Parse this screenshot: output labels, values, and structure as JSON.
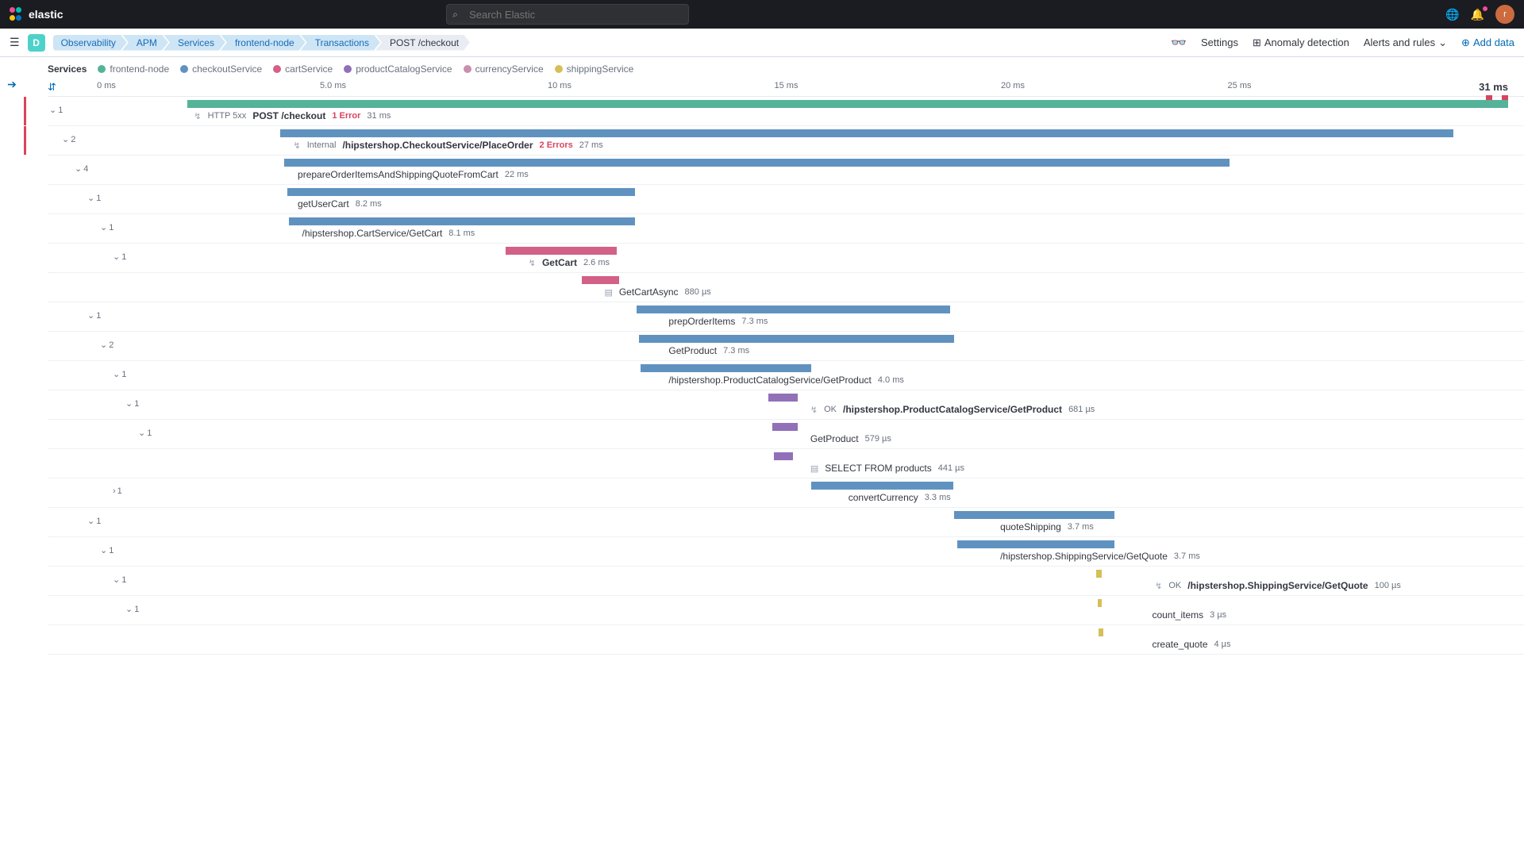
{
  "header": {
    "brand": "elastic",
    "search_placeholder": "Search Elastic",
    "space_initial": "D",
    "avatar_initial": "r"
  },
  "breadcrumbs": [
    "Observability",
    "APM",
    "Services",
    "frontend-node",
    "Transactions",
    "POST /checkout"
  ],
  "nav": {
    "settings": "Settings",
    "anomaly": "Anomaly detection",
    "alerts": "Alerts and rules",
    "add_data": "Add data"
  },
  "legend": {
    "title": "Services",
    "items": [
      {
        "name": "frontend-node",
        "color": "#54b399"
      },
      {
        "name": "checkoutService",
        "color": "#6092c0"
      },
      {
        "name": "cartService",
        "color": "#d36086"
      },
      {
        "name": "productCatalogService",
        "color": "#9170b8"
      },
      {
        "name": "currencyService",
        "color": "#ca8eae"
      },
      {
        "name": "shippingService",
        "color": "#d6bf57"
      }
    ]
  },
  "axis": {
    "ticks": [
      "0 ms",
      "5.0 ms",
      "10 ms",
      "15 ms",
      "20 ms",
      "25 ms"
    ],
    "total": "31 ms"
  },
  "trace": [
    {
      "depth": 0,
      "count": "1",
      "err": true,
      "start": 0.058,
      "width": 0.942,
      "color": "#54b399",
      "icon": "net",
      "pre": "HTTP 5xx",
      "name": "POST /checkout",
      "bold": true,
      "errors": "1 Error",
      "dur": "31 ms",
      "lp": 0.06
    },
    {
      "depth": 1,
      "count": "2",
      "err": true,
      "start": 0.124,
      "width": 0.837,
      "color": "#6092c0",
      "icon": "net",
      "pre": "Internal",
      "name": "/hipstershop.CheckoutService/PlaceOrder",
      "bold": true,
      "errors": "2 Errors",
      "dur": "27 ms",
      "lp": 0.128
    },
    {
      "depth": 2,
      "count": "4",
      "start": 0.127,
      "width": 0.674,
      "color": "#6092c0",
      "name": "prepareOrderItemsAndShippingQuoteFromCart",
      "dur": "22 ms",
      "lp": 0.131
    },
    {
      "depth": 3,
      "count": "1",
      "start": 0.129,
      "width": 0.248,
      "color": "#6092c0",
      "name": "getUserCart",
      "dur": "8.2 ms",
      "lp": 0.131
    },
    {
      "depth": 4,
      "count": "1",
      "start": 0.13,
      "width": 0.247,
      "color": "#6092c0",
      "name": "/hipstershop.CartService/GetCart",
      "dur": "8.1 ms",
      "lp": 0.134
    },
    {
      "depth": 5,
      "count": "1",
      "start": 0.285,
      "width": 0.079,
      "color": "#d36086",
      "icon": "net",
      "name": "GetCart",
      "bold": true,
      "dur": "2.6 ms",
      "lp": 0.289
    },
    {
      "depth": 6,
      "count": "",
      "start": 0.339,
      "width": 0.027,
      "color": "#d36086",
      "icon": "db",
      "name": "GetCartAsync",
      "dur": "880 µs",
      "lp": 0.341
    },
    {
      "depth": 3,
      "count": "1",
      "start": 0.378,
      "width": 0.224,
      "color": "#6092c0",
      "name": "prepOrderItems",
      "dur": "7.3 ms",
      "lp": 0.385
    },
    {
      "depth": 4,
      "count": "2",
      "start": 0.38,
      "width": 0.225,
      "color": "#6092c0",
      "name": "GetProduct",
      "dur": "7.3 ms",
      "lp": 0.385
    },
    {
      "depth": 5,
      "count": "1",
      "start": 0.381,
      "width": 0.122,
      "color": "#6092c0",
      "name": "/hipstershop.ProductCatalogService/GetProduct",
      "dur": "4.0 ms",
      "lp": 0.385
    },
    {
      "depth": 6,
      "count": "1",
      "start": 0.472,
      "width": 0.021,
      "color": "#9170b8",
      "icon": "net",
      "pre": "OK",
      "name": "/hipstershop.ProductCatalogService/GetProduct",
      "bold": true,
      "dur": "681 µs",
      "lp": 0.482
    },
    {
      "depth": 7,
      "count": "1",
      "start": 0.475,
      "width": 0.018,
      "color": "#9170b8",
      "name": "GetProduct",
      "dur": "579 µs",
      "lp": 0.482
    },
    {
      "depth": 8,
      "count": "",
      "start": 0.476,
      "width": 0.014,
      "color": "#9170b8",
      "icon": "db",
      "name": "SELECT FROM products",
      "dur": "441 µs",
      "lp": 0.482
    },
    {
      "depth": 5,
      "count": "1",
      "chev": "right",
      "start": 0.503,
      "width": 0.101,
      "color": "#6092c0",
      "name": "convertCurrency",
      "dur": "3.3 ms",
      "lp": 0.508
    },
    {
      "depth": 3,
      "count": "1",
      "start": 0.605,
      "width": 0.114,
      "color": "#6092c0",
      "name": "quoteShipping",
      "dur": "3.7 ms",
      "lp": 0.612
    },
    {
      "depth": 4,
      "count": "1",
      "start": 0.607,
      "width": 0.112,
      "color": "#6092c0",
      "name": "/hipstershop.ShippingService/GetQuote",
      "dur": "3.7 ms",
      "lp": 0.612
    },
    {
      "depth": 5,
      "count": "1",
      "start": 0.706,
      "width": 0.004,
      "color": "#d6bf57",
      "icon": "net",
      "pre": "OK",
      "name": "/hipstershop.ShippingService/GetQuote",
      "bold": true,
      "dur": "100 µs",
      "lp": 0.718
    },
    {
      "depth": 6,
      "count": "1",
      "start": 0.707,
      "width": 0.003,
      "color": "#d6bf57",
      "name": "count_items",
      "dur": "3 µs",
      "lp": 0.716
    },
    {
      "depth": 6,
      "count": "",
      "start": 0.708,
      "width": 0.003,
      "color": "#d6bf57",
      "name": "create_quote",
      "dur": "4 µs",
      "lp": 0.716
    }
  ]
}
